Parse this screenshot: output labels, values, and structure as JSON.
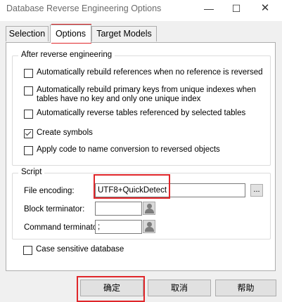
{
  "window": {
    "title": "Database Reverse Engineering Options",
    "minimize_icon": "minimize-icon",
    "maximize_icon": "maximize-icon",
    "close_icon": "close-icon"
  },
  "tabs": [
    {
      "label": "Selection",
      "active": false
    },
    {
      "label": "Options",
      "active": true
    },
    {
      "label": "Target Models",
      "active": false
    }
  ],
  "after_reverse": {
    "legend": "After reverse engineering",
    "options": [
      {
        "label": "Automatically rebuild references when no reference is reversed",
        "checked": false
      },
      {
        "label": "Automatically rebuild primary keys from unique indexes when tables have no key and only one unique index",
        "checked": false
      },
      {
        "label": "Automatically reverse tables referenced by selected tables",
        "checked": false
      },
      {
        "label": "Create symbols",
        "checked": true
      },
      {
        "label": "Apply code to name conversion to reversed objects",
        "checked": false
      }
    ]
  },
  "script": {
    "legend": "Script",
    "file_encoding_label": "File encoding:",
    "file_encoding_value": "UTF8+QuickDetect",
    "browse_label": "...",
    "block_terminator_label": "Block terminator:",
    "block_terminator_value": "",
    "command_terminator_label": "Command terminator:",
    "command_terminator_value": ";"
  },
  "case_sensitive": {
    "label": "Case sensitive database",
    "checked": false
  },
  "buttons": {
    "ok": "确定",
    "cancel": "取消",
    "help": "帮助"
  },
  "colors": {
    "highlight": "#e0262a",
    "panel_bg": "#f0f0f0"
  }
}
